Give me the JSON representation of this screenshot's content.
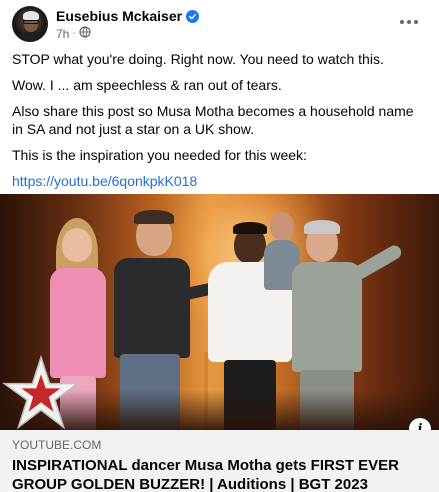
{
  "post": {
    "author": {
      "name": "Eusebius Mckaiser",
      "verified": true,
      "time": "7h",
      "audience_icon": "globe-icon"
    },
    "menu_icon": "more-options-icon",
    "paragraphs": [
      "STOP what you're doing. Right now. You need to watch this.",
      "Wow. I ... am speechless & ran out of tears.",
      "Also share this post so Musa Motha becomes a household name in SA and not just a star on a UK show.",
      "This is the inspiration you needed for this week:"
    ],
    "link_text": "https://youtu.be/6qonkpkK018"
  },
  "preview": {
    "domain": "YOUTUBE.COM",
    "title": "INSPIRATIONAL dancer Musa Motha gets FIRST EVER GROUP GOLDEN BUZZER! | Auditions | BGT 2023",
    "info_icon": "info-icon"
  },
  "colors": {
    "link": "#216fdb",
    "verified_badge": "#1877f2",
    "secondary_text": "#65676b",
    "preview_bg": "#f0f2f5"
  }
}
